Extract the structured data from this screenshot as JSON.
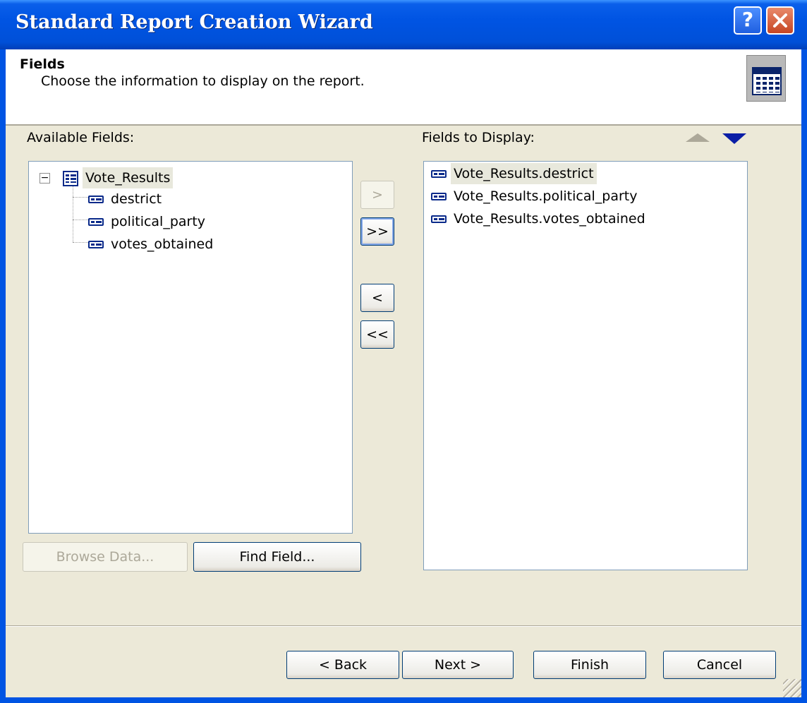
{
  "window": {
    "title": "Standard Report Creation Wizard",
    "help_label": "?"
  },
  "header": {
    "title": "Fields",
    "description": "Choose the information to display on the report."
  },
  "available": {
    "label": "Available Fields:",
    "expander": "−",
    "table": "Vote_Results",
    "fields": [
      "destrict",
      "political_party",
      "votes_obtained"
    ]
  },
  "transfer": {
    "add_one": ">",
    "add_all": ">>",
    "remove_one": "<",
    "remove_all": "<<"
  },
  "display": {
    "label": "Fields to Display:",
    "fields": [
      "Vote_Results.destrict",
      "Vote_Results.political_party",
      "Vote_Results.votes_obtained"
    ]
  },
  "buttons": {
    "browse_data": "Browse Data...",
    "find_field": "Find Field...",
    "back": "< Back",
    "next": "Next >",
    "finish": "Finish",
    "cancel": "Cancel"
  },
  "colors": {
    "titlebar": "#0054e3",
    "dialog_bg": "#ece9d8",
    "icon_blue": "#0a2a8a",
    "move_down_arrow": "#0a1ea6",
    "move_up_arrow_disabled": "#aca899"
  },
  "icons": {
    "close": "close-icon",
    "report": "report-table-icon",
    "table": "table-icon",
    "field": "field-icon",
    "move_up": "triangle-up-icon",
    "move_down": "triangle-down-icon"
  }
}
